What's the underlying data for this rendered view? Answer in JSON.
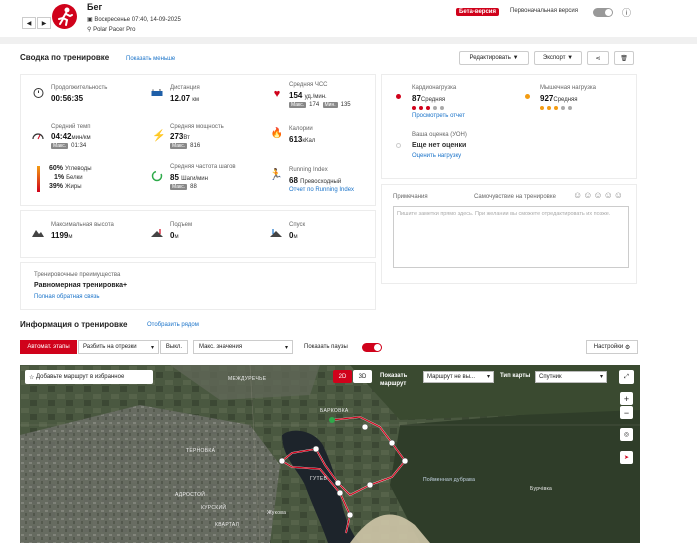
{
  "header": {
    "title": "Бег",
    "datetime": "Воскресенье 07:40, 14-09-2025",
    "device": "Polar Pacer Pro",
    "beta_label": "Бета-версия",
    "original_version_label": "Первоначальная версия",
    "prev": "◀",
    "next": "▶",
    "info": "ⓘ"
  },
  "summary": {
    "title": "Сводка по тренировке",
    "show_less": "Показать меньше",
    "edit_label": "Редактировать",
    "export_label": "Экспорт"
  },
  "metrics": {
    "duration": {
      "label": "Продолжительность",
      "value": "00:56:35"
    },
    "distance": {
      "label": "Дистанция",
      "value": "12.07",
      "unit": "км"
    },
    "hr": {
      "label": "Средняя ЧСС",
      "value": "154",
      "unit": "уд./мин.",
      "max_tag": "Макс.",
      "max": "174",
      "min_tag": "Мин.",
      "min": "135"
    },
    "pace": {
      "label": "Средний темп",
      "value": "04:42",
      "unit": "мин/км",
      "max_tag": "Макс.",
      "max": "01:34"
    },
    "power": {
      "label": "Средняя мощность",
      "value": "273",
      "unit": "Вт",
      "max_tag": "Макс.",
      "max": "816"
    },
    "calories": {
      "label": "Калории",
      "value": "613",
      "unit": "кКал"
    },
    "carbs": {
      "value": "60%",
      "label": "Углеводы"
    },
    "protein": {
      "value": "1%",
      "label": "Белки"
    },
    "fat": {
      "value": "39%",
      "label": "Жиры"
    },
    "cadence": {
      "label": "Средняя частота шагов",
      "value": "85",
      "unit": "Шаги/мин",
      "max_tag": "Макс.",
      "max": "88"
    },
    "running_index": {
      "label": "Running Index",
      "value": "68",
      "unit": "Превосходный",
      "link": "Отчет по Running Index"
    },
    "max_alt": {
      "label": "Максимальная высота",
      "value": "1199",
      "unit": "м"
    },
    "ascent": {
      "label": "Подъем",
      "value": "0",
      "unit": "м"
    },
    "descent": {
      "label": "Спуск",
      "value": "0",
      "unit": "м"
    }
  },
  "benefit": {
    "label": "Тренировочные преимущества",
    "value": "Равномерная тренировка+",
    "link": "Полная обратная связь"
  },
  "load": {
    "cardio": {
      "label": "Кардионагрузка",
      "value": "87",
      "unit": "Средняя",
      "link": "Просмотреть отчет",
      "color": "#d0021b"
    },
    "muscle": {
      "label": "Мышечная нагрузка",
      "value": "927",
      "unit": "Средняя",
      "color": "#f39c12"
    },
    "rpe": {
      "label": "Ваша оценка (УОН)",
      "value": "Еще нет оценки",
      "link": "Оценить нагрузку"
    }
  },
  "notes": {
    "label": "Примечания",
    "feeling_label": "Самочувствие на тренировке",
    "faces": "☺☺☺☺☺",
    "placeholder": "Пишите заметки прямо здесь. При желании вы сможете отредактировать их позже."
  },
  "info": {
    "title": "Информация о тренировке",
    "show_side": "Отобразить рядом",
    "auto_laps": "Автомат. этапы",
    "split": "Разбить на отрезки",
    "off": "Выкл.",
    "max_values": "Макс. значения",
    "show_pauses": "Показать паузы",
    "settings": "Настройки"
  },
  "map": {
    "add_fav": "Добавьте маршрут в избранное",
    "btn_2d": "2D",
    "btn_3d": "3D",
    "show_route": "Показать маршрут",
    "route_sel": "Маршрут не вы...",
    "map_type": "Тип карты",
    "map_type_val": "Спутник",
    "zoom_in": "+",
    "zoom_out": "−",
    "labels": {
      "mezh": "МЕЖДУРЕЧЬЕ",
      "barkovka": "БАРКОВКА",
      "teplovka": "ТЕРНОВКА",
      "gtv": "ГУТЕВ",
      "adrost": "АДРОСТОЙ",
      "poima": "Пойменная дубрава",
      "burkivka": "Бурчівка",
      "kvartal": "КВАРТАЛ",
      "kurskiy": "КУРСКИЙ",
      "zhukova": "Жукова"
    }
  }
}
